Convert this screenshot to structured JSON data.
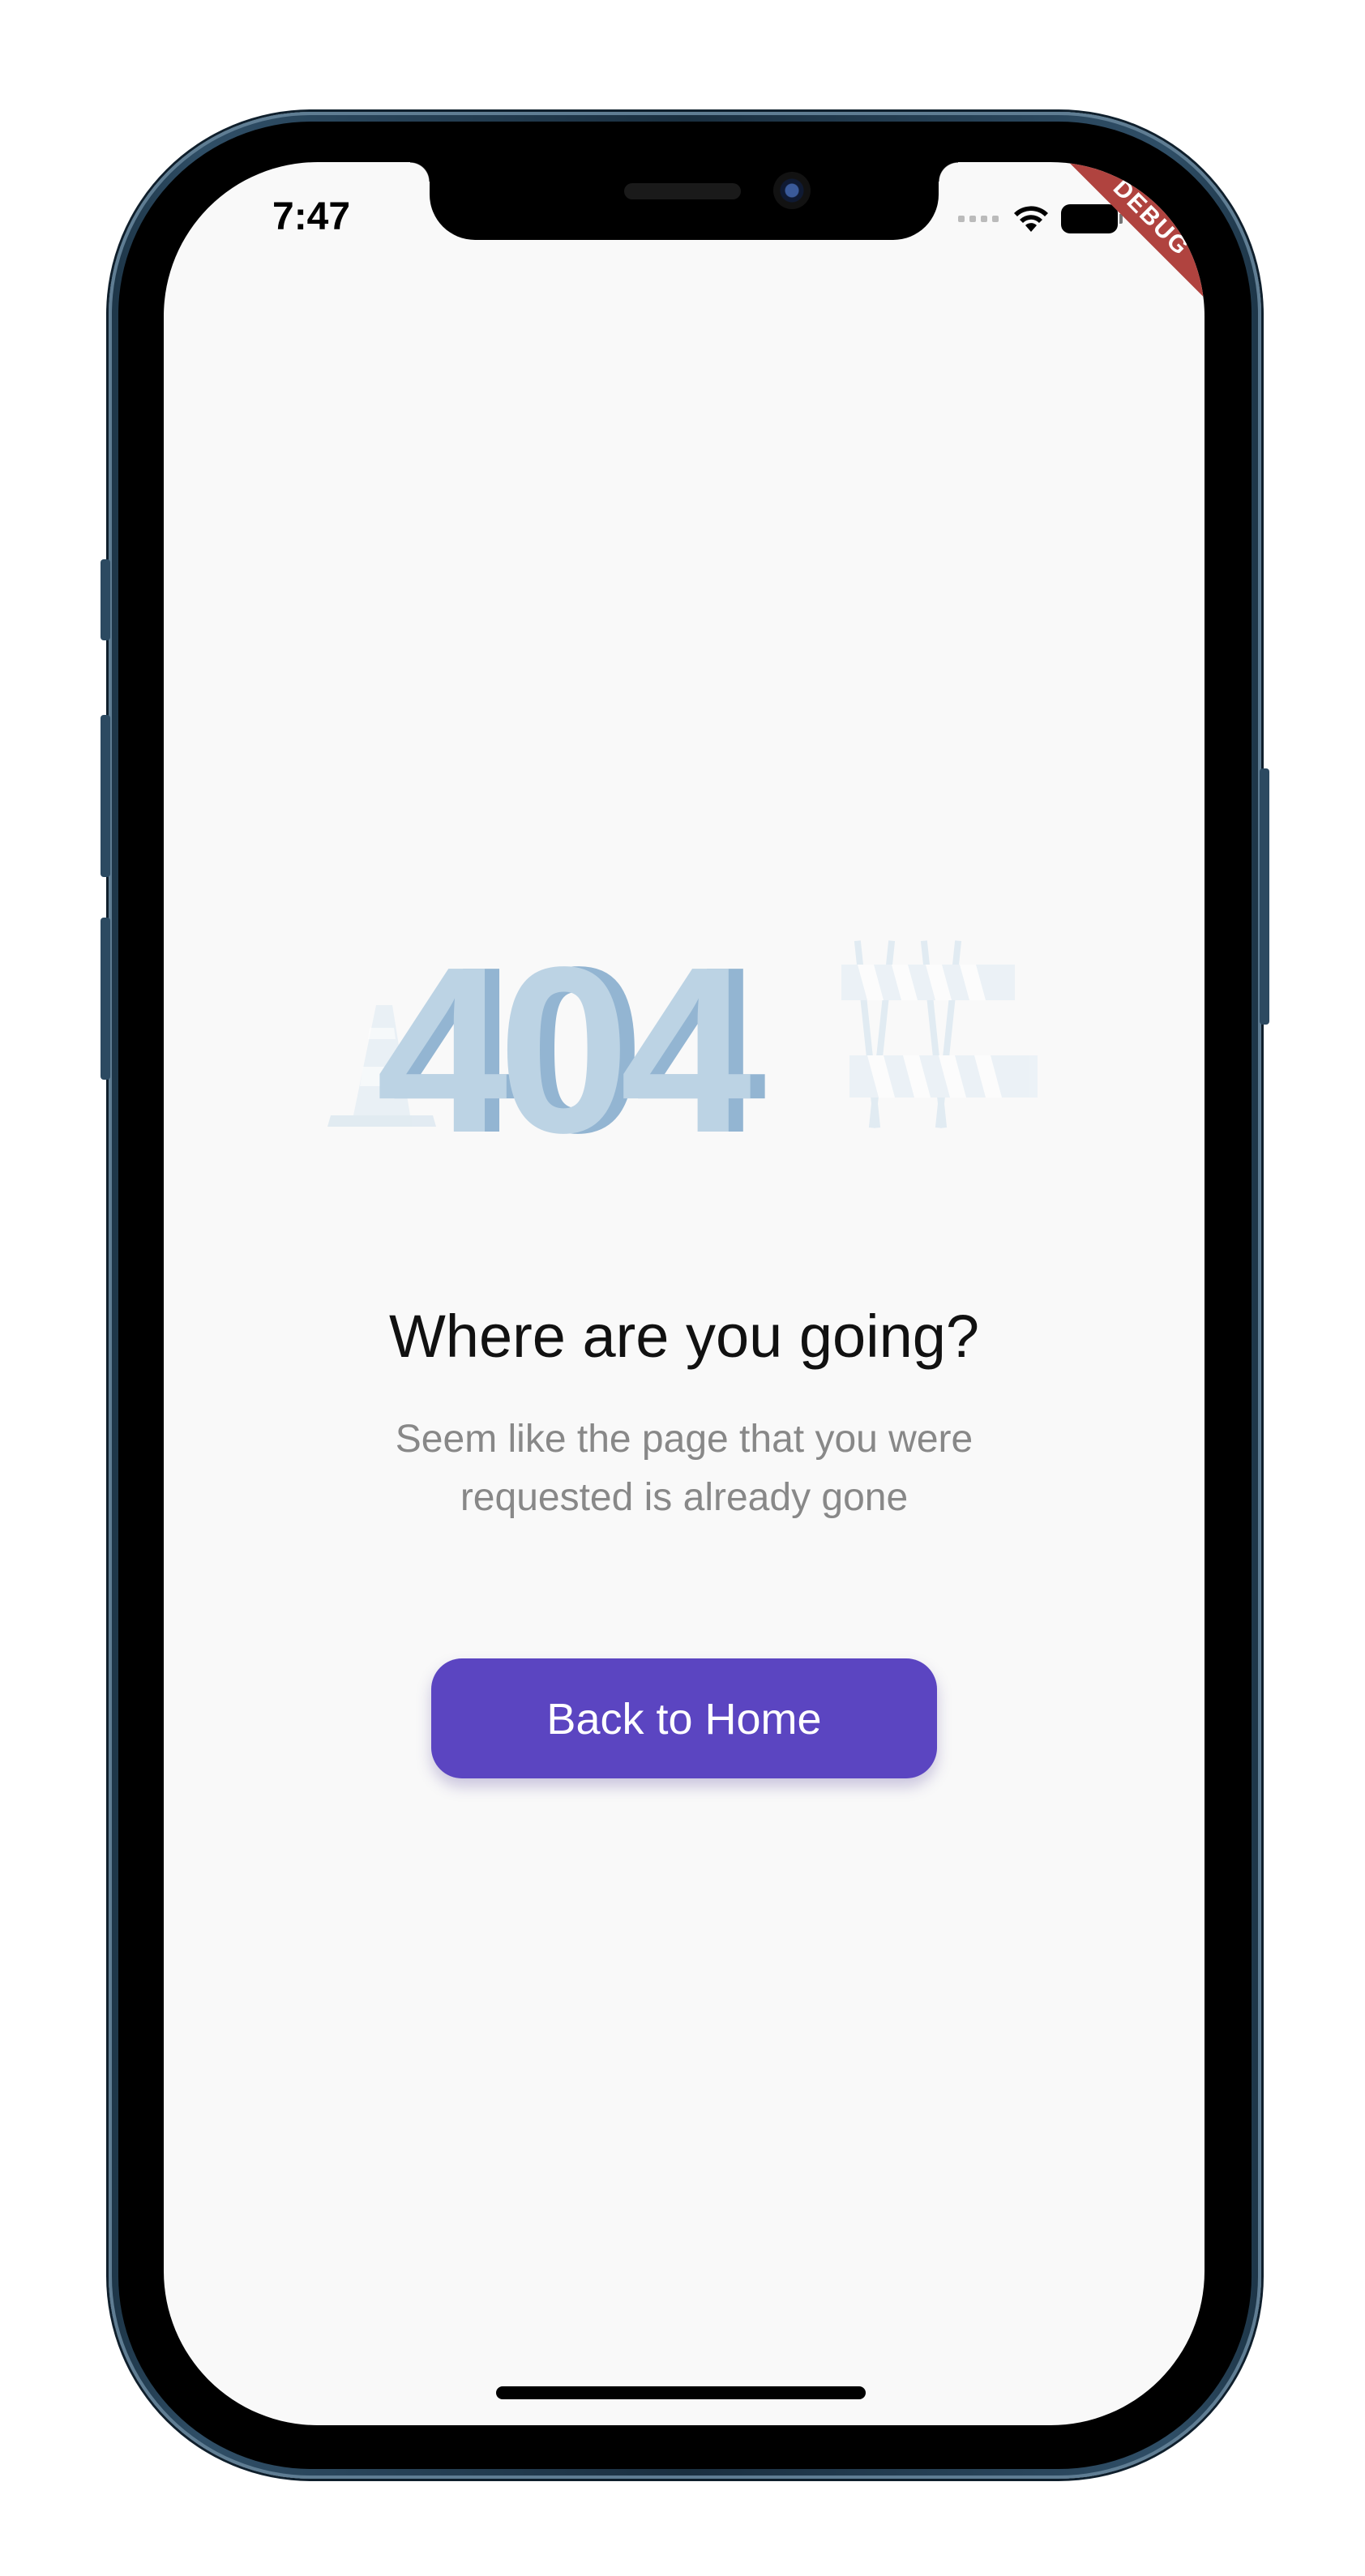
{
  "status_bar": {
    "time": "7:47"
  },
  "debug_banner": {
    "label": "DEBUG"
  },
  "illustration": {
    "code_text": "404"
  },
  "content": {
    "heading": "Where are you going?",
    "description": "Seem like the page that you were requested is already gone",
    "button_label": "Back to Home"
  },
  "colors": {
    "background": "#f9f9f9",
    "primary": "#5b45c1",
    "illustration_light": "#bcd3e4",
    "illustration_dark": "#93b5d2",
    "debug_banner": "#b0433f"
  },
  "icons": [
    "wifi-icon",
    "signal-icon",
    "battery-icon"
  ]
}
